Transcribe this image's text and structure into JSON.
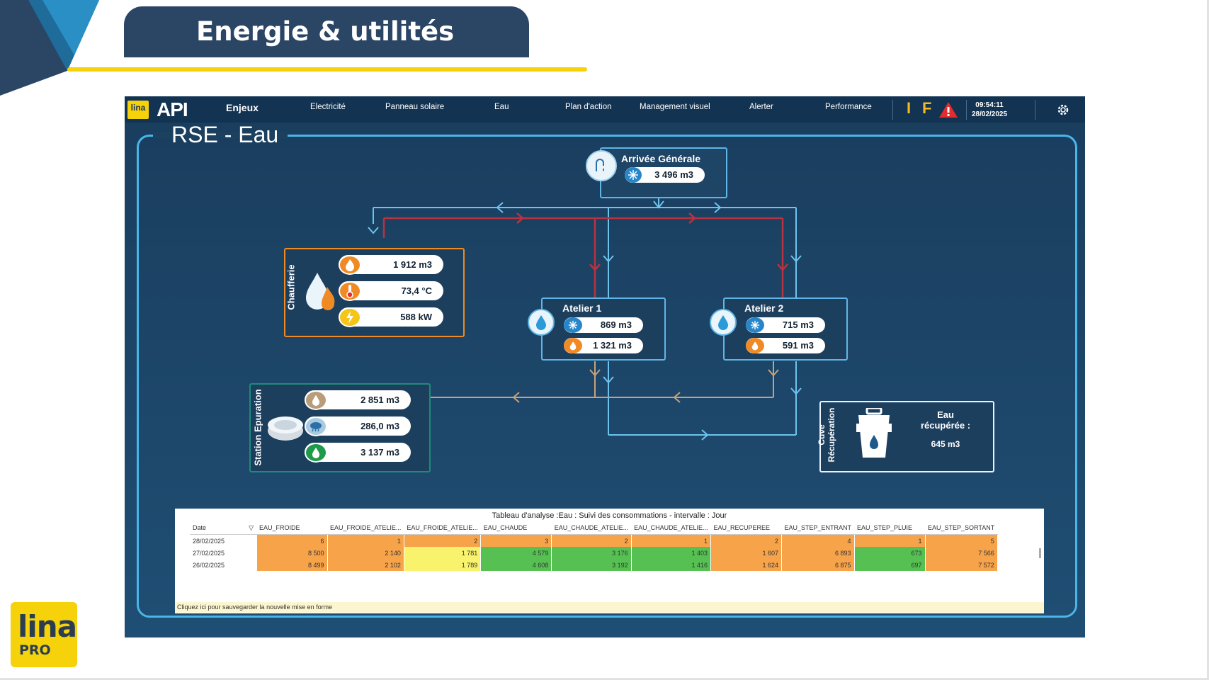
{
  "slide": {
    "title": "Energie & utilités",
    "logo": {
      "line1": "lina",
      "line2": "PRO"
    }
  },
  "app": {
    "mini_logo": "lina",
    "brand": "API",
    "nav": [
      "Enjeux",
      "Electricité",
      "Panneau solaire",
      "Eau",
      "Plan d'action",
      "Management visuel",
      "Alerter",
      "Performance"
    ],
    "indicators": {
      "i": "I",
      "f": "F"
    },
    "time": "09:54:11",
    "date": "28/02/2025",
    "page_title": "RSE - Eau"
  },
  "arrivee": {
    "title": "Arrivée Générale",
    "value": "3 496  m3"
  },
  "chaufferie": {
    "label": "Chaufferie",
    "volume": "1 912  m3",
    "temp": "73,4 °C",
    "power": "588 kW"
  },
  "atelier1": {
    "title": "Atelier 1",
    "cold": "869 m3",
    "hot": "1 321  m3"
  },
  "atelier2": {
    "title": "Atelier 2",
    "cold": "715 m3",
    "hot": "591 m3"
  },
  "station": {
    "label": "Station Epuration",
    "entrant": "2 851  m3",
    "pluie": "286,0 m3",
    "sortant": "3 137  m3"
  },
  "cuve": {
    "label_line1": "Cuve",
    "label_line2": "Récupération",
    "title_line1": "Eau",
    "title_line2": "récupérée :",
    "value": "645 m3"
  },
  "table": {
    "caption": "Tableau d'analyse :Eau : Suivi des consommations - intervalle : Jour",
    "columns": [
      "Date",
      "EAU_FROIDE",
      "EAU_FROIDE_ATELIE...",
      "EAU_FROIDE_ATELIE...",
      "EAU_CHAUDE",
      "EAU_CHAUDE_ATELIE...",
      "EAU_CHAUDE_ATELIE...",
      "EAU_RECUPEREE",
      "EAU_STEP_ENTRANT",
      "EAU_STEP_PLUIE",
      "EAU_STEP_SORTANT"
    ],
    "rows": [
      {
        "cells": [
          "28/02/2025",
          "6",
          "1",
          "2",
          "3",
          "2",
          "1",
          "2",
          "4",
          "1",
          "5"
        ],
        "colors": [
          "d",
          "o",
          "o",
          "o",
          "o",
          "o",
          "o",
          "o",
          "o",
          "o",
          "o"
        ]
      },
      {
        "cells": [
          "27/02/2025",
          "8 500",
          "2 140",
          "1 781",
          "4 579",
          "3 176",
          "1 403",
          "1 607",
          "6 893",
          "673",
          "7 566"
        ],
        "colors": [
          "d",
          "o",
          "o",
          "y",
          "g",
          "g",
          "g",
          "o",
          "o",
          "g",
          "o"
        ]
      },
      {
        "cells": [
          "26/02/2025",
          "8 499",
          "2 102",
          "1 789",
          "4 608",
          "3 192",
          "1 416",
          "1 624",
          "6 875",
          "697",
          "7 572"
        ],
        "colors": [
          "d",
          "o",
          "o",
          "y",
          "g",
          "g",
          "g",
          "o",
          "o",
          "g",
          "o"
        ]
      }
    ],
    "footnote": "Cliquez ici pour sauvegarder la nouvelle mise en forme"
  },
  "colors": {
    "panel": "#1f4e74",
    "frame": "#49b5e8",
    "cold_pipe": "#6ec3ee",
    "hot_pipe": "#b8333f",
    "waste_pipe": "#c7a27a",
    "orange": "#f08a24",
    "yellow": "#f5d20a"
  },
  "icons": [
    "faucet-icon",
    "snowflake-icon",
    "flame-icon",
    "thermometer-icon",
    "lightning-icon",
    "water-drop-icon",
    "rain-cloud-icon",
    "bucket-icon",
    "gear-icon",
    "warning-icon"
  ]
}
